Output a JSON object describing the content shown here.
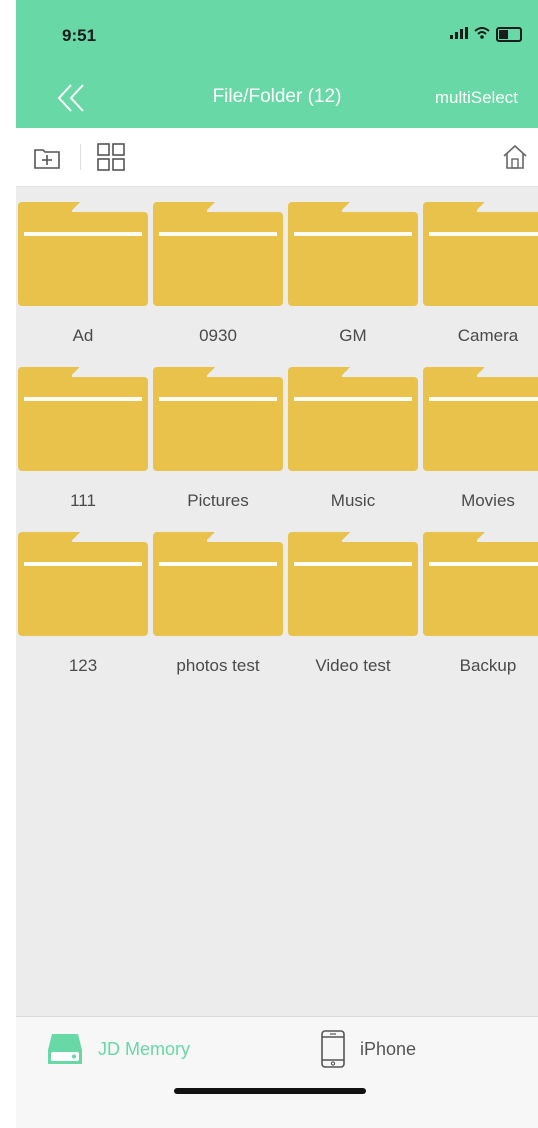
{
  "status_bar": {
    "time": "9:51"
  },
  "header": {
    "title": "File/Folder (12)",
    "multi_select_label": "multiSelect",
    "accent_color": "#67d8a6"
  },
  "toolbar": {
    "icons": [
      "new-folder-icon",
      "grid-view-icon",
      "home-icon"
    ]
  },
  "folders": [
    {
      "label": "Ad"
    },
    {
      "label": "0930"
    },
    {
      "label": "GM"
    },
    {
      "label": "Camera"
    },
    {
      "label": "111"
    },
    {
      "label": "Pictures"
    },
    {
      "label": "Music"
    },
    {
      "label": "Movies"
    },
    {
      "label": "123"
    },
    {
      "label": "photos test"
    },
    {
      "label": "Video test"
    },
    {
      "label": "Backup"
    }
  ],
  "tabbar": {
    "tabs": [
      {
        "label": "JD Memory",
        "active": true,
        "color": "#67d8a6"
      },
      {
        "label": "iPhone",
        "active": false,
        "color": "#555555"
      }
    ]
  }
}
